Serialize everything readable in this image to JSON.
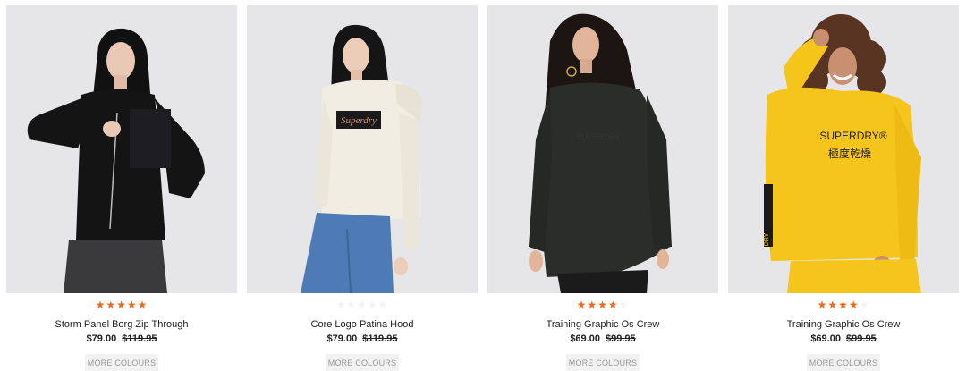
{
  "products": [
    {
      "name": "Storm Panel Borg Zip Through",
      "price": "$79.00",
      "was_price": "$119.95",
      "rating": 5,
      "more_label": "MORE COLOURS",
      "garment_color": "#141414",
      "image": "woman-in-black-borg-zip-jacket"
    },
    {
      "name": "Core Logo Patina Hood",
      "price": "$79.00",
      "was_price": "$119.95",
      "rating": 0,
      "more_label": "MORE COLOURS",
      "garment_color": "#f1ede2",
      "image": "woman-in-cream-logo-hoodie",
      "logo_text": "Superdry"
    },
    {
      "name": "Training Graphic Os Crew",
      "price": "$69.00",
      "was_price": "$99.95",
      "rating": 4,
      "more_label": "MORE COLOURS",
      "garment_color": "#2a2d2a",
      "image": "woman-in-dark-green-crew-sweatshirt"
    },
    {
      "name": "Training Graphic Os Crew",
      "price": "$69.00",
      "was_price": "$99.95",
      "rating": 4,
      "more_label": "MORE COLOURS",
      "garment_color": "#f6c51c",
      "image": "woman-in-yellow-crew-sweatshirt",
      "logo_text": "SUPERDRY®",
      "logo_jp": "極度乾燥",
      "side_tape": "DRY"
    }
  ],
  "colors": {
    "star_active": "#ee6a1c",
    "photo_bg": "#e6e6e8",
    "button_bg": "#f2f2f2"
  }
}
